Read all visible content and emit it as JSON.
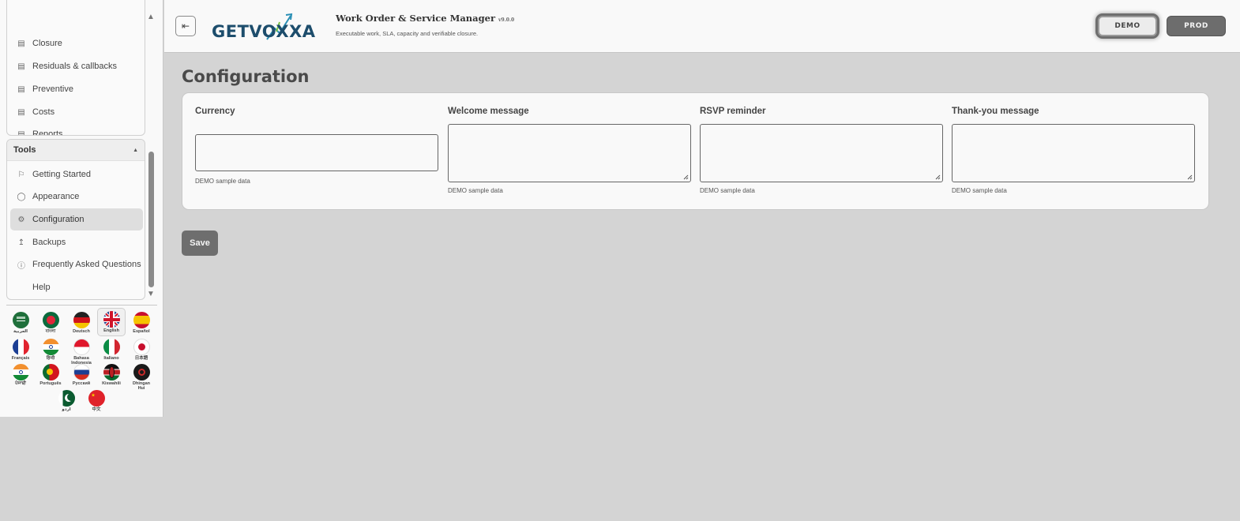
{
  "header": {
    "logo_text": "GETVOXXA",
    "app_title": "Work Order & Service Manager",
    "app_version": "v9.0.0",
    "app_subtitle": "Executable work, SLA, capacity and verifiable closure.",
    "env_buttons": {
      "demo": "DEMO",
      "prod": "PROD"
    },
    "collapse_icon": "collapse-sidebar-icon"
  },
  "sidebar": {
    "top_items": [
      {
        "label": "Closure",
        "icon": "list-icon"
      },
      {
        "label": "Residuals & callbacks",
        "icon": "list-icon"
      },
      {
        "label": "Preventive",
        "icon": "list-icon"
      },
      {
        "label": "Costs",
        "icon": "list-icon"
      },
      {
        "label": "Reports",
        "icon": "list-icon"
      }
    ],
    "tools_header": "Tools",
    "tools_items": [
      {
        "label": "Getting Started",
        "icon": "flag-icon"
      },
      {
        "label": "Appearance",
        "icon": "palette-icon"
      },
      {
        "label": "Configuration",
        "icon": "gear-icon",
        "active": true
      },
      {
        "label": "Backups",
        "icon": "upload-icon"
      },
      {
        "label": "Frequently Asked Questions",
        "icon": "question-icon"
      },
      {
        "label": "Help",
        "icon": ""
      }
    ],
    "languages": [
      {
        "label": "العربية",
        "flag": "sa"
      },
      {
        "label": "বাংলা",
        "flag": "bd"
      },
      {
        "label": "Deutsch",
        "flag": "de"
      },
      {
        "label": "English",
        "flag": "gb",
        "selected": true
      },
      {
        "label": "Español",
        "flag": "es"
      },
      {
        "label": "Français",
        "flag": "fr"
      },
      {
        "label": "हिन्दी",
        "flag": "in"
      },
      {
        "label": "Bahasa Indonesia",
        "flag": "id"
      },
      {
        "label": "Italiano",
        "flag": "it"
      },
      {
        "label": "日本語",
        "flag": "jp"
      },
      {
        "label": "ਪੰਜਾਬੀ",
        "flag": "in"
      },
      {
        "label": "Português",
        "flag": "pt"
      },
      {
        "label": "Русский",
        "flag": "ru"
      },
      {
        "label": "Kiswahili",
        "flag": "ke"
      },
      {
        "label": "Dhingan Hui",
        "flag": "dh"
      },
      {
        "label": "اردو",
        "flag": "pk"
      },
      {
        "label": "中文",
        "flag": "cn"
      }
    ]
  },
  "main": {
    "page_title": "Configuration",
    "fields": [
      {
        "label": "Currency",
        "value": "",
        "helper": "DEMO sample data",
        "type": "input"
      },
      {
        "label": "Welcome message",
        "value": "",
        "helper": "DEMO sample data",
        "type": "textarea"
      },
      {
        "label": "RSVP reminder",
        "value": "",
        "helper": "DEMO sample data",
        "type": "textarea"
      },
      {
        "label": "Thank-you message",
        "value": "",
        "helper": "DEMO sample data",
        "type": "textarea"
      }
    ],
    "save_label": "Save"
  }
}
